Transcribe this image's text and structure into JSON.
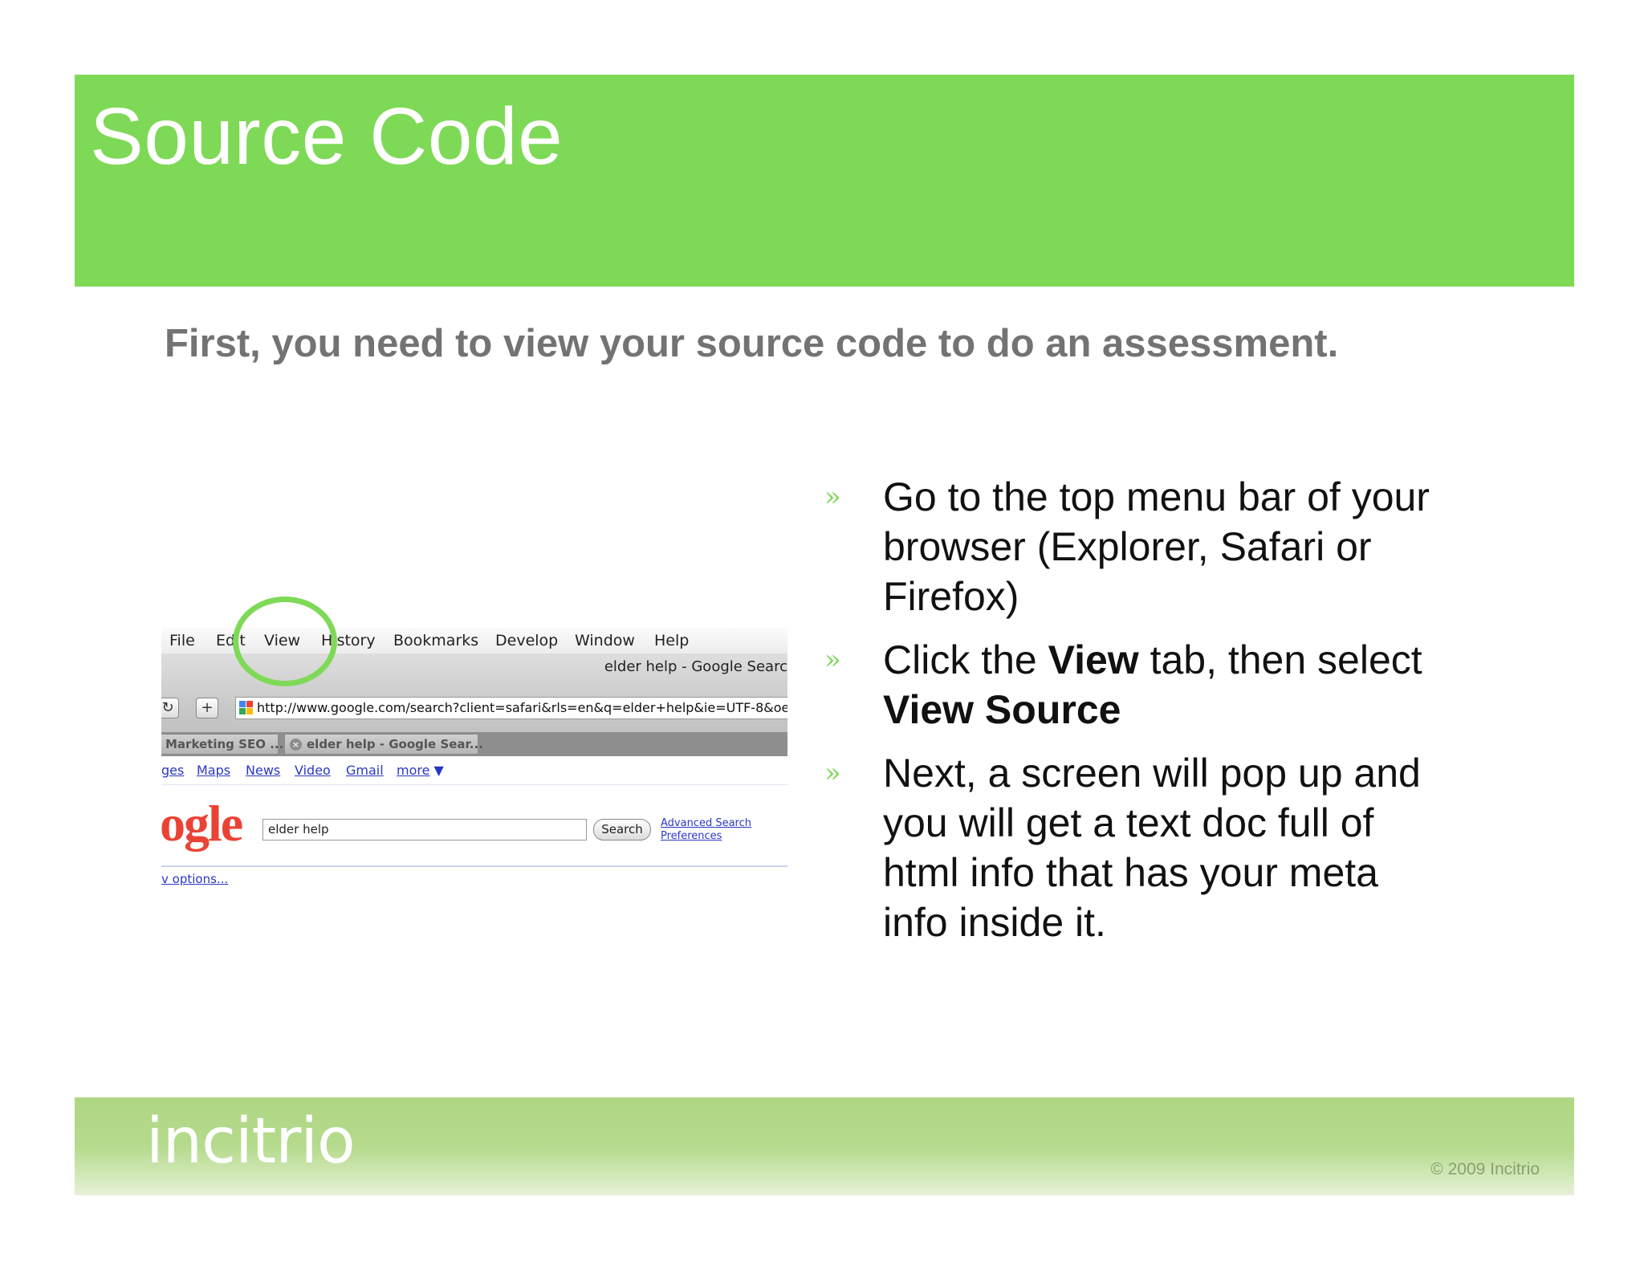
{
  "slide": {
    "title": "Source Code",
    "subtitle": "First, you need to view your source code to do an assessment."
  },
  "colors": {
    "accent": "#7ed957",
    "subtitle": "#737373",
    "footer": "#aed783"
  },
  "screenshot": {
    "menu": [
      "File",
      "Edit",
      "View",
      "History",
      "Bookmarks",
      "Develop",
      "Window",
      "Help"
    ],
    "window_title": "elder help - Google Searc",
    "url": "http://www.google.com/search?client=safari&rls=en&q=elder+help&ie=UTF-8&oe",
    "tabs": [
      "Marketing SEO ...",
      "elder help - Google Sear..."
    ],
    "links": [
      "ges",
      "Maps",
      "News",
      "Video",
      "Gmail",
      "more"
    ],
    "more_arrow": "▼",
    "logo": "ogle",
    "search_value": "elder help",
    "search_button": "Search",
    "advanced_search": "Advanced Search",
    "preferences": "Preferences",
    "options": "v options..."
  },
  "bullets": [
    {
      "mark": "»",
      "text": "Go to the top menu bar of your browser (Explorer, Safari or Firefox)"
    },
    {
      "mark": "»",
      "t1": "Click the ",
      "b1": "View",
      "t2": " tab, then select ",
      "b2": "View Source"
    },
    {
      "mark": "»",
      "text": "Next, a screen will pop up and you will get a text doc full of html info that has your meta info inside it."
    }
  ],
  "footer": {
    "brand": "incitrio",
    "copyright": "© 2009 Incitrio"
  }
}
